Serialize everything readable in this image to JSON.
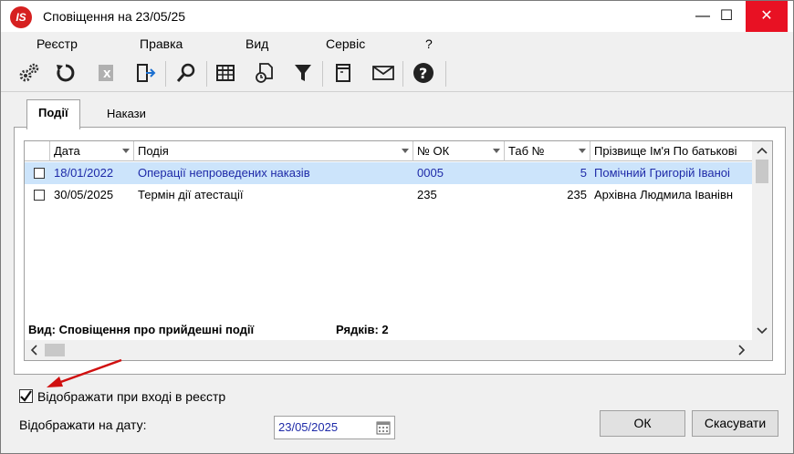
{
  "window": {
    "title": "Сповіщення на 23/05/25",
    "app_icon": "IS",
    "controls": {
      "minimize": "—",
      "maximize": "☐",
      "close": "✕"
    }
  },
  "menu": [
    "Реєстр",
    "Правка",
    "Вид",
    "Сервіс",
    "?"
  ],
  "toolbar": {
    "icons": [
      "settings-gears-icon",
      "refresh-icon",
      "excel-export-icon",
      "exit-door-icon",
      "search-icon",
      "grid-view-icon",
      "document-clock-icon",
      "filter-icon",
      "note-icon",
      "mail-icon",
      "help-icon"
    ]
  },
  "tabs": [
    {
      "label": "Події",
      "active": true
    },
    {
      "label": "Накази",
      "active": false
    }
  ],
  "grid": {
    "columns": [
      "Дата",
      "Подія",
      "№ ОК",
      "Таб №",
      "Прізвище Ім'я По батькові"
    ],
    "rows": [
      {
        "checked": false,
        "date": "18/01/2022",
        "event": "Операції непроведених наказів",
        "ok": "0005",
        "tab": "5",
        "name": "Помічний Григорій Іваноі",
        "selected": true
      },
      {
        "checked": false,
        "date": "30/05/2025",
        "event": "Термін дії атестації",
        "ok": "235",
        "tab": "235",
        "name": "Архівна Людмила Іванівн",
        "selected": false
      }
    ]
  },
  "status": {
    "view_label": "Вид: Сповіщення про прийдешні події",
    "rows_label": "Рядків: 2"
  },
  "footer": {
    "show_on_entry_label": "Відображати при вході в реєстр",
    "show_on_entry_checked": true,
    "show_on_date_label": "Відображати на дату:",
    "date_value": "23/05/2025",
    "ok_label": "ОК",
    "cancel_label": "Скасувати"
  },
  "colors": {
    "selected_row": "#cce4fb",
    "selected_text": "#1e2aa8",
    "close_button": "#e81123",
    "arrow": "#d01010"
  }
}
